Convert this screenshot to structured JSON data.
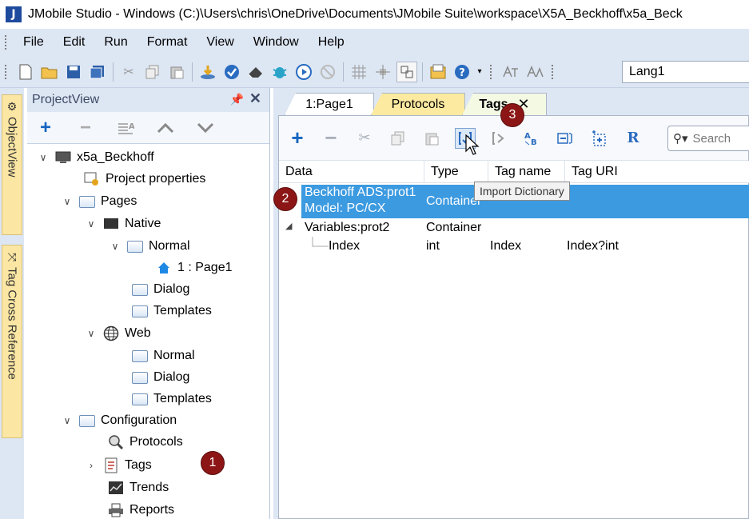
{
  "window": {
    "logo": "J",
    "title": "JMobile Studio - Windows (C:)\\Users\\chris\\OneDrive\\Documents\\JMobile Suite\\workspace\\X5A_Beckhoff\\x5a_Beck"
  },
  "menu": {
    "items": [
      "File",
      "Edit",
      "Run",
      "Format",
      "View",
      "Window",
      "Help"
    ]
  },
  "toolbar": {
    "language": "Lang1"
  },
  "dock": {
    "object_view": "ObjectView",
    "tag_cross_reference": "Tag Cross Reference"
  },
  "project_view": {
    "title": "ProjectView",
    "tree": {
      "root": "x5a_Beckhoff",
      "project_properties": "Project properties",
      "pages": "Pages",
      "native": "Native",
      "normal": "Normal",
      "page1": "1 : Page1",
      "dialog": "Dialog",
      "templates": "Templates",
      "web": "Web",
      "web_normal": "Normal",
      "web_dialog": "Dialog",
      "web_templates": "Templates",
      "configuration": "Configuration",
      "protocols": "Protocols",
      "tags": "Tags",
      "trends": "Trends",
      "reports": "Reports"
    }
  },
  "doc_tabs": {
    "page1": "1:Page1",
    "protocols": "Protocols",
    "tags": "Tags",
    "close": "✕"
  },
  "tags_editor": {
    "search_placeholder": "Search",
    "tooltip": "Import Dictionary",
    "columns": {
      "data": "Data",
      "type": "Type",
      "tag_name": "Tag name",
      "tag_uri": "Tag URI"
    },
    "rows": {
      "beckhoff_line1": "Beckhoff ADS:prot1",
      "beckhoff_line2": "Model: PC/CX",
      "beckhoff_type": "Container",
      "variables_name": "Variables:prot2",
      "variables_type": "Container",
      "index_name": "Index",
      "index_type": "int",
      "index_tagname": "Index",
      "index_uri": "Index?int"
    }
  },
  "callouts": {
    "one": "1",
    "two": "2",
    "three": "3"
  },
  "colors": {
    "selection": "#3c9ae0",
    "badge": "#8c1616",
    "panel": "#dde6f3",
    "protocols_tab": "#fbeaa0"
  }
}
